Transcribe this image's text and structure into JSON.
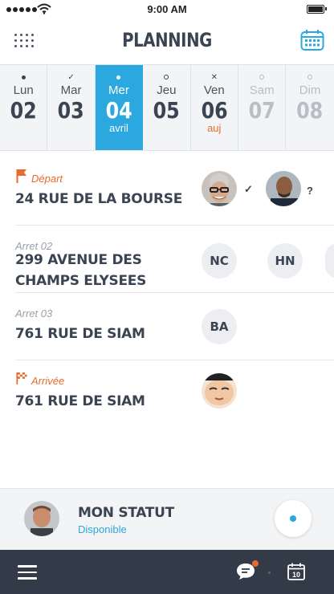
{
  "status_bar": {
    "time": "9:00 AM"
  },
  "header": {
    "title": "PLANNING",
    "menu_icon": "grid-dots-icon",
    "calendar_icon": "calendar-icon"
  },
  "days": [
    {
      "name": "Lun",
      "num": "02",
      "mark": "dot",
      "sub": "",
      "state": "past"
    },
    {
      "name": "Mar",
      "num": "03",
      "mark": "check",
      "sub": "",
      "state": "past"
    },
    {
      "name": "Mer",
      "num": "04",
      "mark": "dot",
      "sub": "avril",
      "state": "active"
    },
    {
      "name": "Jeu",
      "num": "05",
      "mark": "ring",
      "sub": "",
      "state": "normal"
    },
    {
      "name": "Ven",
      "num": "06",
      "mark": "cross",
      "sub": "auj",
      "state": "today"
    },
    {
      "name": "Sam",
      "num": "07",
      "mark": "ring",
      "sub": "",
      "state": "future"
    },
    {
      "name": "Dim",
      "num": "08",
      "mark": "ring",
      "sub": "",
      "state": "future"
    }
  ],
  "stops": [
    {
      "label": "Départ",
      "address": "24 RUE DE LA BOURSE",
      "crew": [
        {
          "type": "photo",
          "name": "grey-hair-glasses-man",
          "state": "✓"
        },
        {
          "type": "photo",
          "name": "bald-man",
          "state": "?"
        }
      ]
    },
    {
      "label": "Arret 02",
      "address": "299 AVENUE DES CHAMPS ELYSEES",
      "crew": [
        {
          "type": "initials",
          "text": "NC"
        },
        {
          "type": "initials",
          "text": "HN"
        },
        {
          "type": "initials",
          "text": ""
        }
      ]
    },
    {
      "label": "Arret 03",
      "address": "761 RUE DE SIAM",
      "crew": [
        {
          "type": "initials",
          "text": "BA"
        }
      ]
    },
    {
      "label": "Arrivée",
      "address": "761 RUE DE SIAM",
      "crew": [
        {
          "type": "photo",
          "name": "smiling-face"
        }
      ]
    }
  ],
  "status": {
    "label": "MON STATUT",
    "value": "Disponible"
  },
  "colors": {
    "accent": "#2aa8df",
    "orange": "#e96a2c",
    "dark": "#323b47"
  },
  "bottom_bar": {
    "menu_icon": "hamburger-icon",
    "chat_icon": "chat-icon",
    "calendar_icon": "calendar-10-icon",
    "calendar_day": "10"
  }
}
